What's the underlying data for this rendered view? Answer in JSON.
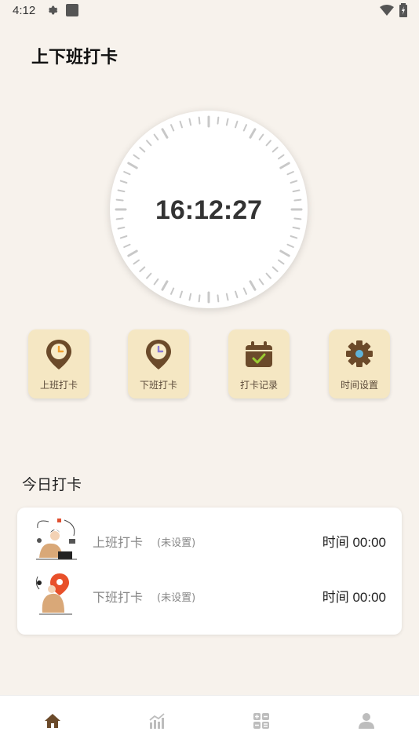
{
  "status_bar": {
    "time": "4:12"
  },
  "page": {
    "title": "上下班打卡"
  },
  "clock": {
    "time": "16:12:27"
  },
  "actions": [
    {
      "label": "上班打卡",
      "icon": "location-clock-icon"
    },
    {
      "label": "下班打卡",
      "icon": "location-clock-icon"
    },
    {
      "label": "打卡记录",
      "icon": "calendar-check-icon"
    },
    {
      "label": "时间设置",
      "icon": "gear-icon"
    }
  ],
  "today": {
    "title": "今日打卡",
    "rows": [
      {
        "label": "上班打卡",
        "status": "(未设置)",
        "time": "时间 00:00"
      },
      {
        "label": "下班打卡",
        "status": "(未设置)",
        "time": "时间 00:00"
      }
    ]
  },
  "nav": [
    {
      "icon": "home-icon",
      "active": true
    },
    {
      "icon": "stats-icon",
      "active": false
    },
    {
      "icon": "grid-icon",
      "active": false
    },
    {
      "icon": "user-icon",
      "active": false
    }
  ],
  "colors": {
    "background": "#F7F2EC",
    "action_tile": "#F5E7C3",
    "icon_brown": "#6B4A2A",
    "accent_orange": "#F0A030",
    "nav_active": "#6B4A2A",
    "nav_inactive": "#BDBDBD"
  }
}
